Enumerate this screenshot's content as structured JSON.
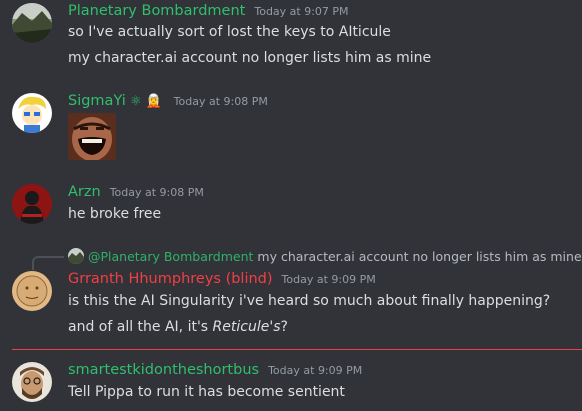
{
  "colors": {
    "background": "#313338",
    "green_name": "#2fbf6d",
    "red_name": "#f23f43",
    "text": "#dbdee1",
    "timestamp": "#949ba4",
    "new_divider": "#f23f43"
  },
  "messages": [
    {
      "author": "Planetary Bombardment",
      "timestamp": "Today at 9:07 PM",
      "lines": [
        "so I've actually sort of lost the keys to AIticule",
        "my character.ai account no longer lists him as mine"
      ],
      "avatar_icon": "landscape-icon"
    },
    {
      "author": "SigmaYi",
      "badges": [
        "⚛",
        "🧝"
      ],
      "timestamp": "Today at 9:08 PM",
      "attachment_icon": "laughing-face-image",
      "avatar_icon": "cartoon-face-icon"
    },
    {
      "author": "Arzn",
      "timestamp": "Today at 9:08 PM",
      "lines": [
        "he broke free"
      ],
      "avatar_icon": "dark-figure-icon"
    },
    {
      "reply_author": "@Planetary Bombardment",
      "reply_text": "my character.ai account no longer lists him as mine",
      "author": "Grranth Hhumphreys (blind)",
      "timestamp": "Today at 9:09 PM",
      "line1": "is this the AI Singularity i've heard so much about finally happening?",
      "line2_prefix": "and of all the AI, it's ",
      "line2_italic": "Reticule's",
      "line2_suffix": "?",
      "avatar_icon": "sketched-face-icon"
    },
    {
      "author": "smartestkidontheshortbus",
      "timestamp": "Today at 9:09 PM",
      "lines": [
        "Tell Pippa to run it has become sentient"
      ],
      "avatar_icon": "bearded-face-icon"
    }
  ]
}
